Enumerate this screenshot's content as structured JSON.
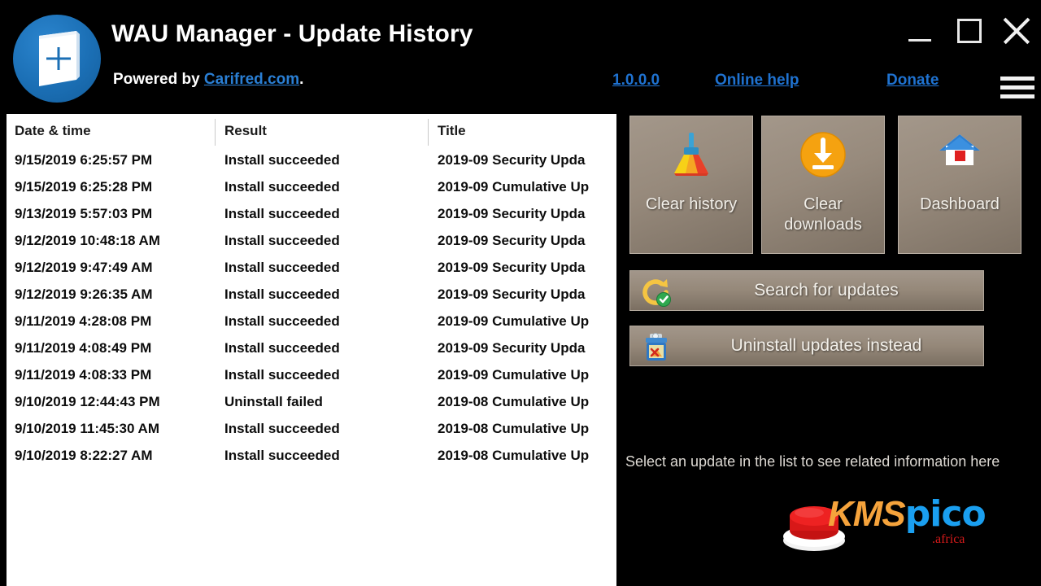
{
  "window": {
    "title": "WAU Manager - Update History",
    "powered_prefix": "Powered by ",
    "powered_link": "Carifred.com",
    "powered_suffix": ".",
    "app_icon": "wau-manager-icon",
    "minimize_label": "_",
    "maximize_label": "□",
    "close_label": "×",
    "menu_icon": "hamburger-menu-icon"
  },
  "header_links": {
    "version": "1.0.0.0",
    "online_help": "Online help",
    "donate": "Donate"
  },
  "list": {
    "columns": [
      "Date & time",
      "Result",
      "Title"
    ],
    "rows": [
      {
        "date": "9/15/2019 6:25:57 PM",
        "result": "Install succeeded",
        "title": "2019-09 Security Upda"
      },
      {
        "date": "9/15/2019 6:25:28 PM",
        "result": "Install succeeded",
        "title": "2019-09 Cumulative Up"
      },
      {
        "date": "9/13/2019 5:57:03 PM",
        "result": "Install succeeded",
        "title": "2019-09 Security Upda"
      },
      {
        "date": "9/12/2019 10:48:18 AM",
        "result": "Install succeeded",
        "title": "2019-09 Security Upda"
      },
      {
        "date": "9/12/2019 9:47:49 AM",
        "result": "Install succeeded",
        "title": "2019-09 Security Upda"
      },
      {
        "date": "9/12/2019 9:26:35 AM",
        "result": "Install succeeded",
        "title": "2019-09 Security Upda"
      },
      {
        "date": "9/11/2019 4:28:08 PM",
        "result": "Install succeeded",
        "title": "2019-09 Cumulative Up"
      },
      {
        "date": "9/11/2019 4:08:49 PM",
        "result": "Install succeeded",
        "title": "2019-09 Security Upda"
      },
      {
        "date": "9/11/2019 4:08:33 PM",
        "result": "Install succeeded",
        "title": "2019-09 Cumulative Up"
      },
      {
        "date": "9/10/2019 12:44:43 PM",
        "result": "Uninstall failed",
        "title": "2019-08 Cumulative Up"
      },
      {
        "date": "9/10/2019 11:45:30 AM",
        "result": "Install succeeded",
        "title": "2019-08 Cumulative Up"
      },
      {
        "date": "9/10/2019 8:22:27 AM",
        "result": "Install succeeded",
        "title": "2019-08 Cumulative Up"
      }
    ]
  },
  "side_panel": {
    "tiles": [
      {
        "label": "Clear history",
        "icon": "broom-icon"
      },
      {
        "label": "Clear downloads",
        "icon": "download-circle-icon"
      },
      {
        "label": "Dashboard",
        "icon": "home-icon"
      }
    ],
    "buttons": [
      {
        "label": "Search for updates",
        "icon": "refresh-check-icon"
      },
      {
        "label": "Uninstall updates instead",
        "icon": "uninstall-bin-icon"
      }
    ],
    "info_text": "Select an update in the list to see related information here"
  },
  "watermark": {
    "brand_kms": "KMS",
    "brand_pico": "pico",
    "tld": ".africa",
    "icon": "red-button-icon"
  },
  "colors": {
    "background": "#000000",
    "link": "#1f72d0",
    "list_background": "#ffffff",
    "tile_top": "#a3978a",
    "tile_bottom": "#7d7164",
    "text_light": "#f2efe9"
  }
}
